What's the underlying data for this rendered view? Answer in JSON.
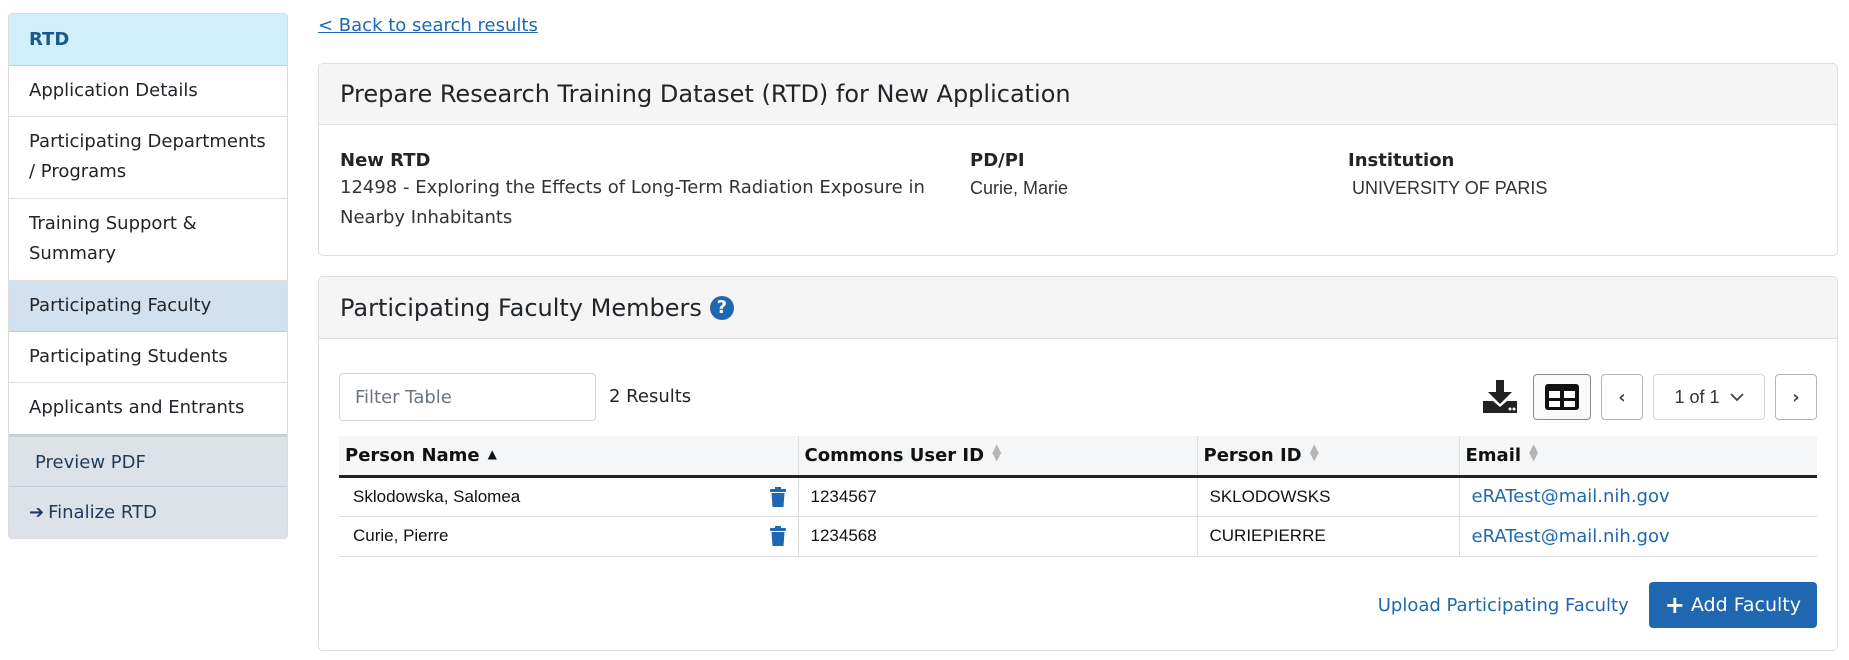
{
  "sidebar": {
    "header": "RTD",
    "items": [
      {
        "label": "Application Details",
        "active": false
      },
      {
        "label": "Participating Departments / Programs",
        "active": false
      },
      {
        "label": "Training Support & Summary",
        "active": false
      },
      {
        "label": "Participating Faculty",
        "active": true
      },
      {
        "label": "Participating Students",
        "active": false
      },
      {
        "label": "Applicants and Entrants",
        "active": false
      }
    ],
    "actions": {
      "preview": "Preview PDF",
      "finalize": "Finalize RTD",
      "finalize_icon": "arrow-right-icon"
    }
  },
  "back_link": "< Back to search results",
  "summary": {
    "title": "Prepare Research Training Dataset (RTD) for New Application",
    "rtd_label": "New RTD",
    "rtd_value": "12498 - Exploring the Effects of Long-Term Radiation Exposure in Nearby Inhabitants",
    "pdpi_label": "PD/PI",
    "pdpi_value": "Curie, Marie",
    "institution_label": "Institution",
    "institution_value": "UNIVERSITY OF PARIS"
  },
  "faculty": {
    "title": "Participating Faculty Members",
    "help_icon": "question-circle-icon",
    "filter_placeholder": "Filter Table",
    "filter_value": "",
    "results": "2 Results",
    "download_icon": "download-icon",
    "grid_icon": "table-grid-icon",
    "pagination": {
      "prev": "‹",
      "current": "1 of 1",
      "next": "›"
    },
    "columns": [
      {
        "label": "Person Name",
        "sort": "asc"
      },
      {
        "label": "Commons User ID",
        "sort": "none"
      },
      {
        "label": "Person ID",
        "sort": "none"
      },
      {
        "label": "Email",
        "sort": "none"
      }
    ],
    "rows": [
      {
        "name": "Sklodowska, Salomea",
        "commons_id": "1234567",
        "person_id": "SKLODOWSKS",
        "email": "eRATest@mail.nih.gov"
      },
      {
        "name": "Curie, Pierre",
        "commons_id": "1234568",
        "person_id": "CURIEPIERRE",
        "email": "eRATest@mail.nih.gov"
      }
    ],
    "upload_link": "Upload Participating Faculty",
    "add_button": "Add Faculty"
  },
  "colors": {
    "accent": "#1f67b1",
    "sidebar_header_bg": "#cff0fa",
    "sidebar_active_bg": "#d2e1ef",
    "sidebar_action_bg": "#dde2e8"
  }
}
